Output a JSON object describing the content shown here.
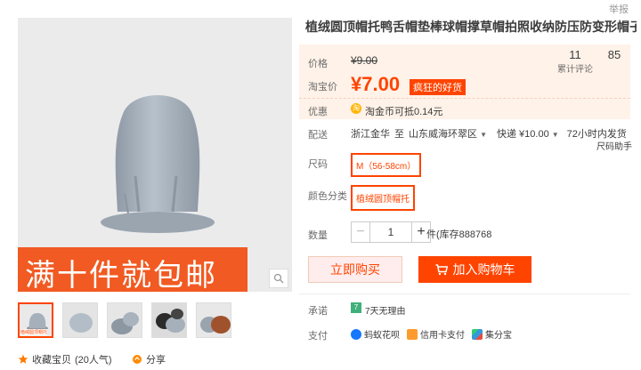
{
  "report": "举报",
  "banner_text": "满十件就包邮",
  "thumb_caption": "植绒圆顶帽托",
  "collect": {
    "label": "收藏宝贝",
    "count": "(20人气)"
  },
  "share_label": "分享",
  "title": "植绒圆顶帽托鸭舌帽垫棒球帽撑草帽拍照收纳防压防变形帽子展示架",
  "price": {
    "label": "价格",
    "original": "¥9.00",
    "tb_label": "淘宝价",
    "tb_price": "¥7.00",
    "promo": "疯狂的好货",
    "perk_label": "优惠",
    "coin_icon_glyph": "淘",
    "coin_text": "淘金币可抵0.14元"
  },
  "stats": {
    "reviews_num": "11",
    "reviews_label": "累计评论",
    "sales_num": "85"
  },
  "shipping": {
    "label": "配送",
    "from": "浙江金华",
    "to_word": "至",
    "to": "山东威海环翠区",
    "method": "快递 ¥10.00",
    "time": "72小时内发货"
  },
  "size": {
    "label": "尺码",
    "value": "M（56-58cm）",
    "helper": "尺码助手"
  },
  "color": {
    "label": "颜色分类",
    "value": "植绒圆顶帽托"
  },
  "quantity": {
    "label": "数量",
    "value": "1",
    "minus": "−",
    "plus": "+",
    "stock": "件(库存888768"
  },
  "buttons": {
    "buy": "立即购买",
    "cart": "加入购物车"
  },
  "promise": {
    "label": "承诺",
    "icon_glyph": "7",
    "text": "7天无理由"
  },
  "payment": {
    "label": "支付",
    "methods": [
      "蚂蚁花呗",
      "信用卡支付",
      "集分宝"
    ]
  },
  "colors": {
    "accent": "#ff4400",
    "price_bg": "#fff2e8",
    "hat": "#a9b4bf",
    "banner": "#f15a22"
  }
}
